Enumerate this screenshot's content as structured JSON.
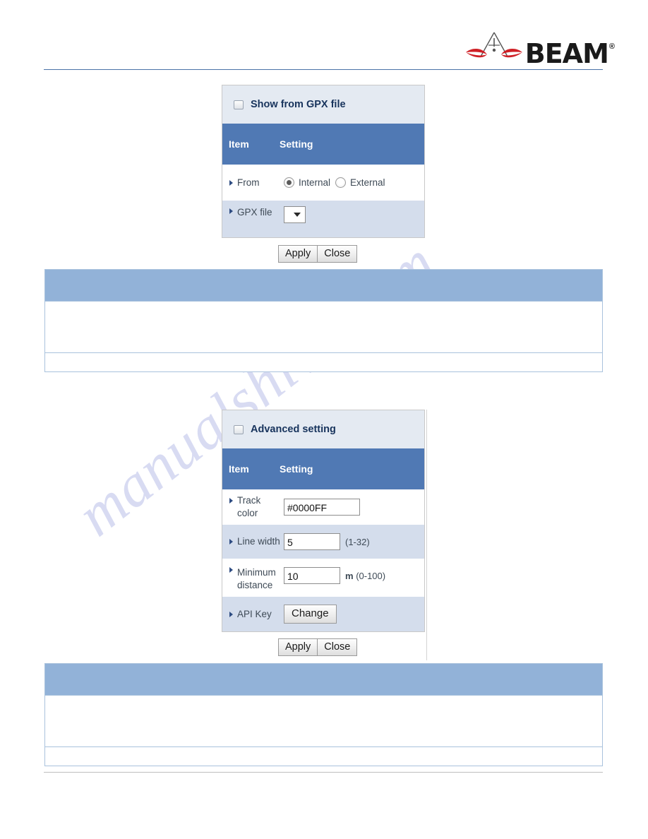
{
  "header": {
    "brand_name": "BEAM",
    "brand_reg": "®",
    "logo_icon": "beam-antenna-logo"
  },
  "watermark": {
    "text": "manualshive.com"
  },
  "panels": [
    {
      "id": "show-from-gpx-file",
      "title": "Show from GPX file",
      "collapse_icon": "minimize-box-icon",
      "columns": {
        "item": "Item",
        "setting": "Setting"
      },
      "rows": [
        {
          "label": "From",
          "type": "radio",
          "options": [
            {
              "label": "Internal",
              "selected": true
            },
            {
              "label": "External",
              "selected": false
            }
          ]
        },
        {
          "label": "GPX file",
          "type": "select",
          "value": "",
          "dropdown_icon": "chevron-down-icon"
        }
      ],
      "actions": {
        "apply": "Apply",
        "close": "Close"
      }
    },
    {
      "id": "advanced-setting",
      "title": "Advanced setting",
      "collapse_icon": "minimize-box-icon",
      "columns": {
        "item": "Item",
        "setting": "Setting"
      },
      "rows": [
        {
          "label": "Track color",
          "type": "text",
          "value": "#0000FF",
          "hint": ""
        },
        {
          "label": "Line width",
          "type": "text",
          "value": "5",
          "hint": "(1-32)"
        },
        {
          "label": "Minimum distance",
          "type": "text",
          "value": "10",
          "unit": "m",
          "hint": "(0-100)"
        },
        {
          "label": "API Key",
          "type": "button",
          "button_label": "Change"
        }
      ],
      "actions": {
        "apply": "Apply",
        "close": "Close"
      }
    }
  ],
  "note_tables": [
    {
      "id": "note-table-top",
      "header_text": "",
      "body_text": "",
      "footer_text": ""
    },
    {
      "id": "note-table-bottom",
      "header_text": "",
      "body_text": "",
      "footer_text": ""
    }
  ],
  "colors": {
    "panel_header_blue": "#5079b4",
    "panel_title_bg": "#e4eaf2",
    "row_blue": "#d4ddec",
    "note_header_blue": "#92b2d8",
    "rule_blue": "#4a73a8",
    "brand_red": "#cf2026",
    "watermark": "#b9bfe8"
  }
}
